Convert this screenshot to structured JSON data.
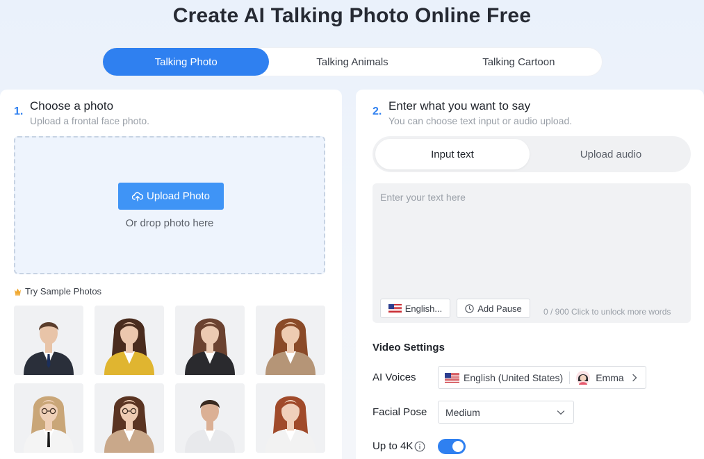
{
  "page": {
    "title": "Create AI Talking Photo Online Free"
  },
  "tabs": [
    {
      "label": "Talking Photo",
      "active": true
    },
    {
      "label": "Talking Animals",
      "active": false
    },
    {
      "label": "Talking Cartoon",
      "active": false
    }
  ],
  "step1": {
    "number": "1.",
    "title": "Choose a photo",
    "subtitle": "Upload a frontal face photo.",
    "upload_label": "Upload Photo",
    "drop_text": "Or drop photo here",
    "sample_label": "Try Sample Photos",
    "samples": [
      {
        "name": "man in dark suit",
        "bg": "#f0f1f3",
        "outfit": "#2a2f3a",
        "hair": "#5a3d2b",
        "skin": "#e8c4a8"
      },
      {
        "name": "woman in yellow blazer",
        "bg": "#f0f1f3",
        "outfit": "#e0b530",
        "hair": "#4a2c1e",
        "skin": "#ecc7ae"
      },
      {
        "name": "woman in black blazer",
        "bg": "#f0f1f3",
        "outfit": "#2a2a2e",
        "hair": "#6b4230",
        "skin": "#eccab2"
      },
      {
        "name": "woman in beige blazer",
        "bg": "#f0f1f3",
        "outfit": "#b59577",
        "hair": "#8a4a28",
        "skin": "#eecbb2"
      },
      {
        "name": "woman with glasses and tie",
        "bg": "#f0f1f3",
        "outfit": "#f4f4f4",
        "hair": "#c9a678",
        "skin": "#efd0b8"
      },
      {
        "name": "woman in tan blazer",
        "bg": "#f0f1f3",
        "outfit": "#c9a88a",
        "hair": "#5a3422",
        "skin": "#eecbb2"
      },
      {
        "name": "man in white suit",
        "bg": "#f0f1f3",
        "outfit": "#e8e9ec",
        "hair": "#3a2a20",
        "skin": "#dbb095"
      },
      {
        "name": "red haired woman",
        "bg": "#f0f1f3",
        "outfit": "#f2f2f2",
        "hair": "#a04a2a",
        "skin": "#f0d0bb"
      }
    ]
  },
  "step2": {
    "number": "2.",
    "title": "Enter what you want to say",
    "subtitle": "You can choose text input or audio upload.",
    "mode_tabs": [
      {
        "label": "Input text",
        "active": true
      },
      {
        "label": "Upload audio",
        "active": false
      }
    ],
    "textarea_placeholder": "Enter your text here",
    "language_button": "English...",
    "pause_button": "Add Pause",
    "word_count": "0 / 900",
    "unlock_text": "Click to unlock more words"
  },
  "video_settings": {
    "title": "Video Settings",
    "ai_voices_label": "AI Voices",
    "voice_language": "English (United States)",
    "voice_name": "Emma",
    "facial_pose_label": "Facial Pose",
    "facial_pose_value": "Medium",
    "resolution_label": "Up to 4K",
    "resolution_enabled": true
  },
  "colors": {
    "accent": "#2f80f0",
    "upload_button": "#3f94f6"
  },
  "icons": {
    "upload": "cloud-upload-icon",
    "crown": "crown-icon",
    "flag": "us-flag-icon",
    "clock": "clock-icon",
    "info": "info-icon",
    "chevron_right": "chevron-right-icon",
    "chevron_down": "chevron-down-icon"
  }
}
